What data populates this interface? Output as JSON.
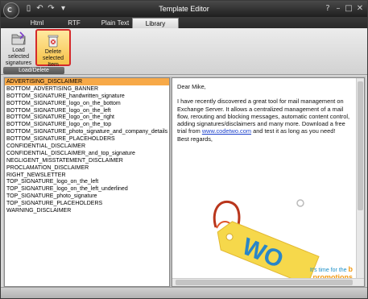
{
  "window": {
    "title": "Template Editor"
  },
  "app_button": {
    "label": "C"
  },
  "quick_access": [
    {
      "name": "new-document-icon",
      "glyph": "▯"
    },
    {
      "name": "undo-icon",
      "glyph": "↶"
    },
    {
      "name": "redo-icon",
      "glyph": "↷"
    },
    {
      "name": "customize-toolbar-icon",
      "glyph": "▾"
    }
  ],
  "window_controls": [
    {
      "name": "help-icon",
      "glyph": "?"
    },
    {
      "name": "minimize-icon",
      "glyph": "–"
    },
    {
      "name": "maximize-icon",
      "glyph": "□"
    },
    {
      "name": "close-icon",
      "glyph": "✕"
    }
  ],
  "tabs": [
    {
      "label": "Html"
    },
    {
      "label": "RTF"
    },
    {
      "label": "Plain Text"
    },
    {
      "label": "Library",
      "active": true
    }
  ],
  "ribbon": {
    "group_label": "Load/Delete",
    "load_button": "Load selected signatures",
    "delete_button": "Delete selected Item"
  },
  "templates": [
    "ADVERTISING_DISCLAIMER",
    "BOTTOM_ADVERTISING_BANNER",
    "BOTTOM_SIGNATURE_handwritten_signature",
    "BOTTOM_SIGNATURE_logo_on_the_bottom",
    "BOTTOM_SIGNATURE_logo_on_the_left",
    "BOTTOM_SIGNATURE_logo_on_the_right",
    "BOTTOM_SIGNATURE_logo_on_the_top",
    "BOTTOM_SIGNATURE_photo_signature_and_company_details",
    "BOTTOM_SIGNATURE_PLACEHOLDERS",
    "CONFIDENTIAL_DISCLAIMER",
    "CONFIDENTIAL_DISCLAIMER_and_top_signature",
    "NEGLIGENT_MISSTATEMENT_DISCLAIMER",
    "PROCLAMATION_DISCLAIMER",
    "RIGHT_NEWSLETTER",
    "TOP_SIGNATURE_logo_on_the_left",
    "TOP_SIGNATURE_logo_on_the_left_underlined",
    "TOP_SIGNATURE_photo_signature",
    "TOP_SIGNATURE_PLACEHOLDERS",
    "WARNING_DISCLAIMER"
  ],
  "selected_template_index": 0,
  "preview": {
    "greeting": "Dear Mike,",
    "body_before_link": "I have recently discovered a great tool for mail management on Exchange Server. It allows a centralized management of a mail flow, rerouting and blocking messages, automatic content control, adding signatures/disclaimers and many more. Download a free trial from",
    "link": "www.codetwo.com",
    "body_after_link": "and test it as long as you need!",
    "closing": "Best regards,",
    "promo_line1": "It's time for the",
    "promo_line1_accent": "b",
    "promo_line2": "promotions",
    "tag_text": "WO"
  },
  "colors": {
    "selection": "#f7a948",
    "accent_orange": "#f39a12",
    "tag_yellow": "#f6d84b",
    "tag_text_blue": "#2a86c8",
    "link_blue": "#1a3fcc"
  }
}
